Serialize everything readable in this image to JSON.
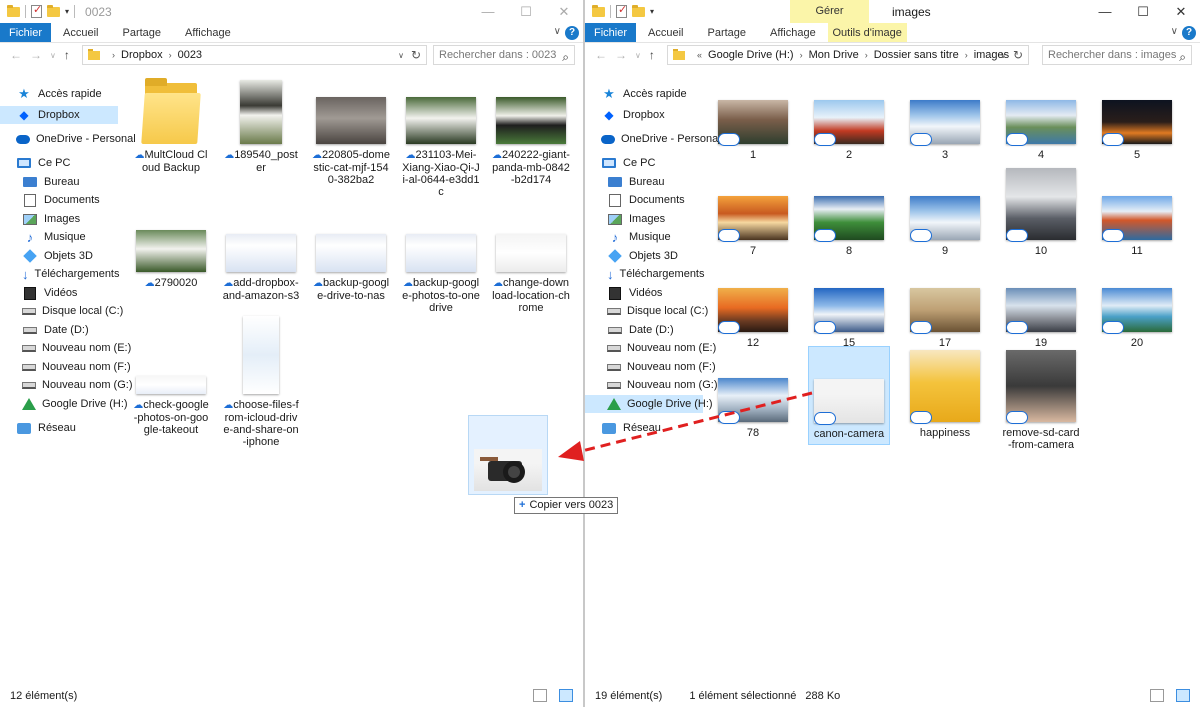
{
  "left_window": {
    "title": "0023",
    "ribbon_tabs": [
      "Fichier",
      "Accueil",
      "Partage",
      "Affichage"
    ],
    "breadcrumb": [
      "Dropbox",
      "0023"
    ],
    "search_placeholder": "Rechercher dans : 0023",
    "status_count": "12 élément(s)",
    "files": [
      {
        "name": "MultCloud Cloud Backup",
        "kind": "folder",
        "cloud": true
      },
      {
        "name": "189540_poster",
        "kind": "panda-poster",
        "cloud": true
      },
      {
        "name": "220805-domestic-cat-mjf-1540-382ba2",
        "kind": "cat",
        "cloud": true
      },
      {
        "name": "231103-Mei-Xiang-Xiao-Qi-Ji-al-0644-e3dd1c",
        "kind": "panda-a",
        "cloud": true
      },
      {
        "name": "240222-giant-panda-mb-0842-b2d174",
        "kind": "panda-b",
        "cloud": true
      },
      {
        "name": "2790020",
        "kind": "panda-c",
        "cloud": true
      },
      {
        "name": "add-dropbox-and-amazon-s3",
        "kind": "shot",
        "cloud": true
      },
      {
        "name": "backup-google-drive-to-nas",
        "kind": "shot",
        "cloud": true
      },
      {
        "name": "backup-google-photos-to-onedrive",
        "kind": "shot",
        "cloud": true
      },
      {
        "name": "change-download-location-chrome",
        "kind": "shot-light",
        "cloud": true
      },
      {
        "name": "check-google-photos-on-google-takeout",
        "kind": "shot-wide",
        "cloud": true
      },
      {
        "name": "choose-files-from-icloud-drive-and-share-on-iphone",
        "kind": "phone",
        "cloud": true
      }
    ]
  },
  "right_window": {
    "title": "images",
    "context_tab_top": "Gérer",
    "ribbon_tabs": [
      "Fichier",
      "Accueil",
      "Partage",
      "Affichage"
    ],
    "context_tab": "Outils d'image",
    "breadcrumb": [
      "Google Drive (H:)",
      "Mon Drive",
      "Dossier sans titre",
      "images"
    ],
    "breadcrumb_prefix": "«",
    "search_placeholder": "Rechercher dans : images",
    "status_count": "19 élément(s)",
    "status_selection": "1 élément sélectionné",
    "status_size": "288 Ko",
    "files": [
      {
        "name": "1",
        "theme": "dolomites"
      },
      {
        "name": "2",
        "theme": "fuji"
      },
      {
        "name": "3",
        "theme": "snow-range"
      },
      {
        "name": "4",
        "theme": "lake"
      },
      {
        "name": "5",
        "theme": "night"
      },
      {
        "name": "7",
        "theme": "sunset-peak"
      },
      {
        "name": "8",
        "theme": "green-valley"
      },
      {
        "name": "9",
        "theme": "snow-range"
      },
      {
        "name": "10",
        "theme": "climber"
      },
      {
        "name": "11",
        "theme": "autumn-lake"
      },
      {
        "name": "12",
        "theme": "sunrise"
      },
      {
        "name": "15",
        "theme": "blue-peaks"
      },
      {
        "name": "17",
        "theme": "cyclist"
      },
      {
        "name": "19",
        "theme": "matterhorn"
      },
      {
        "name": "20",
        "theme": "patagonia"
      },
      {
        "name": "78",
        "theme": "alps"
      },
      {
        "name": "canon-camera",
        "theme": "camera",
        "selected": true
      },
      {
        "name": "happiness",
        "theme": "smile"
      },
      {
        "name": "remove-sd-card-from-camera",
        "theme": "sd-card"
      }
    ]
  },
  "nav_pane": [
    {
      "label": "Accès rapide",
      "icon": "star-icon",
      "level": 0
    },
    {
      "label": "Dropbox",
      "icon": "dropbox-icon",
      "level": 0
    },
    {
      "label": "OneDrive - Personal",
      "icon": "onedrive-icon",
      "level": 0
    },
    {
      "label": "Ce PC",
      "icon": "pc-icon",
      "level": 0
    },
    {
      "label": "Bureau",
      "icon": "desktop-icon",
      "level": 1
    },
    {
      "label": "Documents",
      "icon": "documents-icon",
      "level": 1
    },
    {
      "label": "Images",
      "icon": "pictures-icon",
      "level": 1
    },
    {
      "label": "Musique",
      "icon": "music-icon",
      "level": 1
    },
    {
      "label": "Objets 3D",
      "icon": "objects3d-icon",
      "level": 1
    },
    {
      "label": "Téléchargements",
      "icon": "downloads-icon",
      "level": 1
    },
    {
      "label": "Vidéos",
      "icon": "videos-icon",
      "level": 1
    },
    {
      "label": "Disque local (C:)",
      "icon": "drive-icon",
      "level": 1
    },
    {
      "label": "Date (D:)",
      "icon": "drive-icon",
      "level": 1
    },
    {
      "label": "Nouveau nom (E:)",
      "icon": "drive-icon",
      "level": 1
    },
    {
      "label": "Nouveau nom (F:)",
      "icon": "drive-icon",
      "level": 1
    },
    {
      "label": "Nouveau nom (G:)",
      "icon": "drive-icon",
      "level": 1
    },
    {
      "label": "Google Drive (H:)",
      "icon": "google-drive-icon",
      "level": 1
    },
    {
      "label": "Réseau",
      "icon": "network-icon",
      "level": 0
    }
  ],
  "nav_selected_left": "Dropbox",
  "nav_selected_right": "Google Drive (H:)",
  "drag": {
    "tooltip": "Copier vers 0023"
  },
  "colors": {
    "accent": "#1979ca",
    "selection": "#cce8ff",
    "context_tab": "#fbf5a9",
    "drag_arrow": "#e02020"
  }
}
